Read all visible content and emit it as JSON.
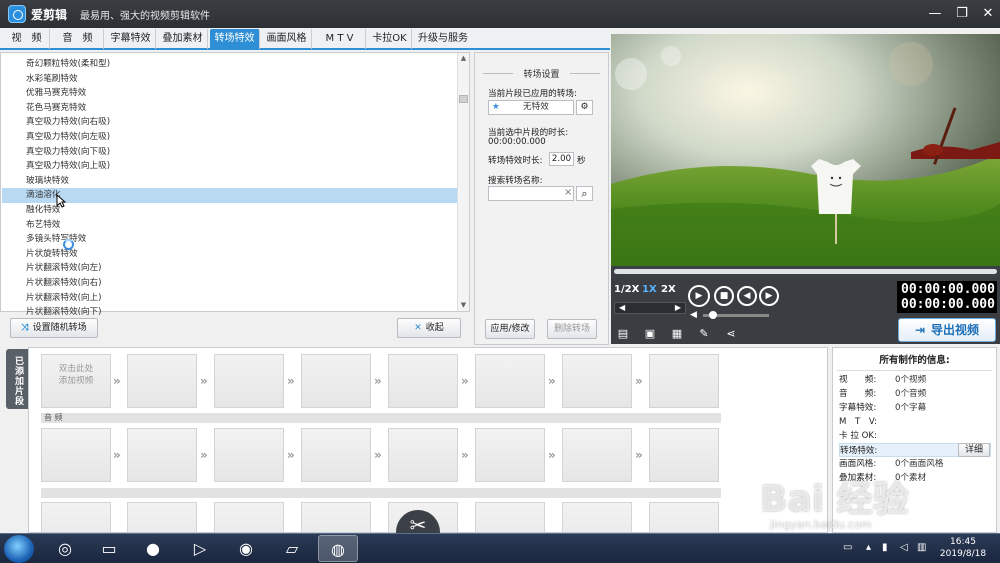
{
  "window": {
    "app_name": "爱剪辑",
    "slogan": "最易用、强大的视频剪辑软件",
    "minimize": "—",
    "restore": "❐",
    "close": "✕"
  },
  "tabs": [
    {
      "label": "视　频",
      "active": false
    },
    {
      "label": "音　频",
      "active": false
    },
    {
      "label": "字幕特效",
      "active": false
    },
    {
      "label": "叠加素材",
      "active": false
    },
    {
      "label": "转场特效",
      "active": true
    },
    {
      "label": "画面风格",
      "active": false
    },
    {
      "label": "M T V",
      "active": false
    },
    {
      "label": "卡拉OK",
      "active": false
    },
    {
      "label": "升级与服务",
      "active": false
    }
  ],
  "effects_list": {
    "items": [
      "奇幻颗粒特效(柔和型)",
      "水彩笔刷特效",
      "优雅马赛克特效",
      "花色马赛克特效",
      "真空吸力特效(向右吸)",
      "真空吸力特效(向左吸)",
      "真空吸力特效(向下吸)",
      "真空吸力特效(向上吸)",
      "玻璃块特效",
      "滴油溶化",
      "融化特效",
      "布艺特效",
      "多镜头特写特效",
      "片状旋转特效",
      "片状翻滚特效(向左)",
      "片状翻滚特效(向右)",
      "片状翻滚特效(向上)",
      "片状翻滚特效(向下)"
    ],
    "selected_index": 9,
    "scroll_up": "▲",
    "scroll_down": "▼"
  },
  "left_buttons": {
    "random": "设置随机转场",
    "random_icon": "⤨",
    "collapse": "收起",
    "collapse_icon": "✕"
  },
  "settings": {
    "title": "转场设置",
    "applied_label": "当前片段已应用的转场:",
    "applied_value": "无特效",
    "applied_icon": "★",
    "selected_duration_label": "当前选中片段的时长:",
    "selected_duration_value": "00:00:00.000",
    "effect_duration_label": "转场特效时长:",
    "effect_duration_value": "2.00",
    "effect_duration_unit": "秒",
    "search_label": "搜索转场名称:",
    "search_value": "",
    "search_clear": "×",
    "search_icon": "⌕",
    "apply_button": "应用/修改",
    "delete_button": "删除转场"
  },
  "player": {
    "speed_options": [
      "1/2X",
      "1X",
      "2X"
    ],
    "selected_speed": "1X",
    "timecode_current": "00:00:00.000",
    "timecode_total": "00:00:00.000",
    "play_icon": "▶",
    "stop_icon": "■",
    "prev_icon": "◀",
    "next_icon": "▶",
    "export_label": "导出视频",
    "export_icon": "⇥",
    "volume_icon": "◀"
  },
  "storyboard": {
    "side_tab": "已添加片段",
    "add_video_hint": "双击此处\n添加视频",
    "audio_track_label": "音 频",
    "scissors_icon": "✂"
  },
  "info_panel": {
    "title": "所有制作的信息:",
    "rows": [
      {
        "key": "视　　频:",
        "value": "0个视频"
      },
      {
        "key": "音　　频:",
        "value": "0个音频"
      },
      {
        "key": "字幕特效:",
        "value": "0个字幕"
      },
      {
        "key": "M　T　V:",
        "value": ""
      },
      {
        "key": "卡 拉 OK:",
        "value": ""
      },
      {
        "key": "转场特效:",
        "value": ""
      },
      {
        "key": "画面风格:",
        "value": "0个画面风格"
      },
      {
        "key": "叠加素材:",
        "value": "0个素材"
      }
    ],
    "details_button": "详细"
  },
  "watermark": {
    "text": "Bai 经验",
    "sub": "jingyan.baidu.com"
  },
  "taskbar": {
    "time": "16:45",
    "date": "2019/8/18"
  }
}
